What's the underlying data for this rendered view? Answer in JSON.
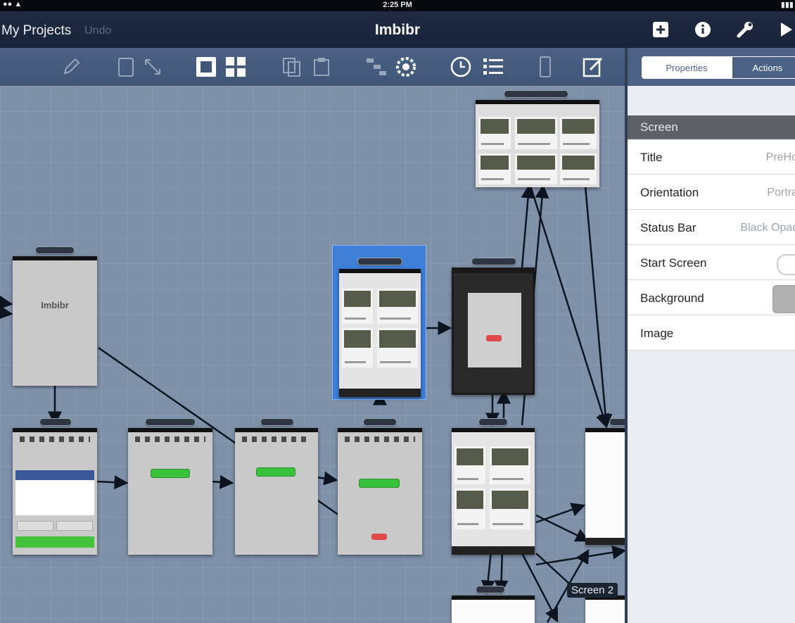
{
  "status_bar": {
    "time": "2:25 PM"
  },
  "nav": {
    "back_label": "My Projects",
    "undo_label": "Undo",
    "title": "Imbibr"
  },
  "panel": {
    "tab_properties": "Properties",
    "tab_actions": "Actions",
    "section_title": "Screen",
    "rows": [
      {
        "label": "Title",
        "value": "PreHo"
      },
      {
        "label": "Orientation",
        "value": "Portra"
      },
      {
        "label": "Status Bar",
        "value": "Black Opaqu"
      },
      {
        "label": "Start Screen",
        "value": ""
      },
      {
        "label": "Background",
        "value": ""
      },
      {
        "label": "Image",
        "value": ""
      }
    ]
  },
  "canvas": {
    "splash_logo": "Imbibr",
    "screen_label": "Screen 2"
  },
  "colors": {
    "nav_bar": "#1f2c40",
    "toolbar": "#4b6285",
    "canvas": "#7e91a8",
    "selection": "#3f7fd8",
    "accent_green": "#38c23c",
    "accent_red": "#e04a4a",
    "facebook": "#3b5998"
  },
  "icons": {
    "nav": [
      "add-screen-icon",
      "info-icon",
      "wrench-icon",
      "play-icon"
    ],
    "toolbar": [
      "pencil-icon",
      "device-icon",
      "resize-icon",
      "fit-icon",
      "grid-icon",
      "copy-icon",
      "paste-icon",
      "flow-icon",
      "settings-icon",
      "clock-icon",
      "list-icon",
      "phone-icon",
      "edit-icon"
    ]
  }
}
